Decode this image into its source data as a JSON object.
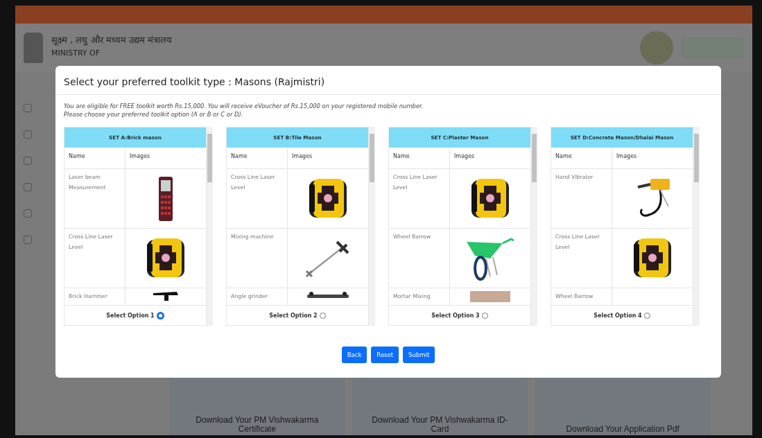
{
  "page": {
    "header": {
      "hindi_title": "सूक्ष्म , लघु और मध्यम उद्यम मंत्रालय",
      "english_title": "MINISTRY OF"
    },
    "download_cards": [
      "Download Your PM Vishwakarma Certificate",
      "Download Your PM Vishwakarma ID-Card",
      "Download Your Application Pdf"
    ]
  },
  "modal": {
    "title": "Select your preferred toolkit type : Masons (Rajmistri)",
    "notice": [
      "You are eligible for FREE toolkit worth Rs.15,000. You will receive eVoucher of Rs.15,000 on your registered mobile number.",
      "Please choose your preferred toolkit option (A or B or C or D)."
    ],
    "sets": [
      {
        "title": "SET A:Brick mason",
        "columns": [
          "Name",
          "Images"
        ],
        "items": [
          "Laser beam Measurement",
          "Cross Line Laser Level",
          "Brick Hammer"
        ],
        "option_label": "Select Option 1",
        "selected": true
      },
      {
        "title": "SET B:Tile Mason",
        "columns": [
          "Name",
          "Images"
        ],
        "items": [
          "Cross Line Laser Level",
          "Mixing machine",
          "Angle grinder"
        ],
        "option_label": "Select Option 2",
        "selected": false
      },
      {
        "title": "SET C:Plaster Mason",
        "columns": [
          "Name",
          "Images"
        ],
        "items": [
          "Cross Line Laser Level",
          "Wheel Barrow",
          "Mortar Mixing"
        ],
        "option_label": "Select Option 3",
        "selected": false
      },
      {
        "title": "SET D:Concrete Mason/Dhalai Mason",
        "columns": [
          "Name",
          "Images"
        ],
        "items": [
          "Hand Vibrator",
          "Cross Line Laser Level",
          "Wheel Barrow"
        ],
        "option_label": "Select Option 4",
        "selected": false
      }
    ],
    "buttons": [
      "Back",
      "Reset",
      "Submit"
    ]
  }
}
